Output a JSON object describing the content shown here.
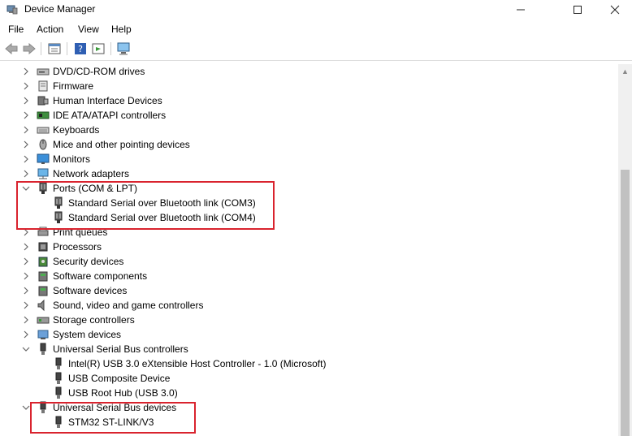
{
  "window": {
    "title": "Device Manager"
  },
  "menu": [
    "File",
    "Action",
    "View",
    "Help"
  ],
  "tree": [
    {
      "label": "DVD/CD-ROM drives",
      "icon": "dvd-drive-icon",
      "expanded": false,
      "level": 0
    },
    {
      "label": "Firmware",
      "icon": "firmware-icon",
      "expanded": false,
      "level": 0
    },
    {
      "label": "Human Interface Devices",
      "icon": "hid-icon",
      "expanded": false,
      "level": 0
    },
    {
      "label": "IDE ATA/ATAPI controllers",
      "icon": "ide-controller-icon",
      "expanded": false,
      "level": 0
    },
    {
      "label": "Keyboards",
      "icon": "keyboard-icon",
      "expanded": false,
      "level": 0
    },
    {
      "label": "Mice and other pointing devices",
      "icon": "mouse-icon",
      "expanded": false,
      "level": 0
    },
    {
      "label": "Monitors",
      "icon": "monitor-icon",
      "expanded": false,
      "level": 0
    },
    {
      "label": "Network adapters",
      "icon": "network-adapter-icon",
      "expanded": false,
      "level": 0
    },
    {
      "label": "Ports (COM & LPT)",
      "icon": "port-icon",
      "expanded": true,
      "level": 0
    },
    {
      "label": "Standard Serial over Bluetooth link (COM3)",
      "icon": "port-icon",
      "level": 1
    },
    {
      "label": "Standard Serial over Bluetooth link (COM4)",
      "icon": "port-icon",
      "level": 1
    },
    {
      "label": "Print queues",
      "icon": "printer-icon",
      "expanded": false,
      "level": 0
    },
    {
      "label": "Processors",
      "icon": "processor-icon",
      "expanded": false,
      "level": 0
    },
    {
      "label": "Security devices",
      "icon": "security-device-icon",
      "expanded": false,
      "level": 0
    },
    {
      "label": "Software components",
      "icon": "software-component-icon",
      "expanded": false,
      "level": 0
    },
    {
      "label": "Software devices",
      "icon": "software-device-icon",
      "expanded": false,
      "level": 0
    },
    {
      "label": "Sound, video and game controllers",
      "icon": "speaker-icon",
      "expanded": false,
      "level": 0
    },
    {
      "label": "Storage controllers",
      "icon": "storage-controller-icon",
      "expanded": false,
      "level": 0
    },
    {
      "label": "System devices",
      "icon": "system-device-icon",
      "expanded": false,
      "level": 0
    },
    {
      "label": "Universal Serial Bus controllers",
      "icon": "usb-icon",
      "expanded": true,
      "level": 0
    },
    {
      "label": "Intel(R) USB 3.0 eXtensible Host Controller - 1.0 (Microsoft)",
      "icon": "usb-icon",
      "level": 1
    },
    {
      "label": "USB Composite Device",
      "icon": "usb-icon",
      "level": 1
    },
    {
      "label": "USB Root Hub (USB 3.0)",
      "icon": "usb-icon",
      "level": 1
    },
    {
      "label": "Universal Serial Bus devices",
      "icon": "usb-icon",
      "expanded": true,
      "level": 0
    },
    {
      "label": "STM32 ST-LINK/V3",
      "icon": "usb-icon",
      "level": 1
    }
  ],
  "colors": {
    "highlight_box": "#d9232e",
    "chevron": "#666666"
  }
}
